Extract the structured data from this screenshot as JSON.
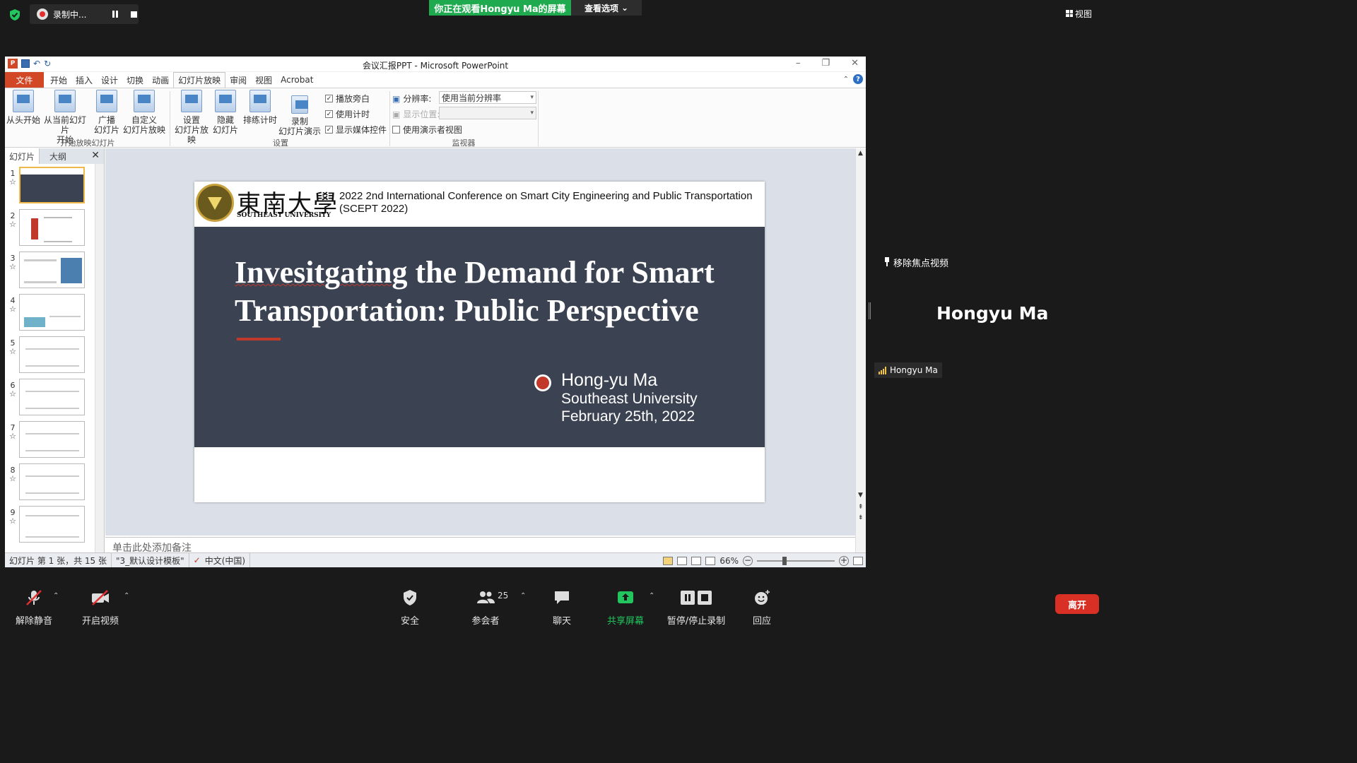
{
  "zoom_top": {
    "recording_label": "录制中...",
    "share_banner": "你正在观看Hongyu  Ma的屏幕",
    "view_options": "查看选项",
    "view_button": "视图"
  },
  "ppt": {
    "window_title": "会议汇报PPT - Microsoft PowerPoint",
    "tabs": [
      "文件",
      "开始",
      "插入",
      "设计",
      "切换",
      "动画",
      "幻灯片放映",
      "审阅",
      "视图",
      "Acrobat"
    ],
    "ribbon": {
      "from_start": "从头开始",
      "from_current_1": "从当前幻灯片",
      "from_current_2": "开始",
      "broadcast_1": "广播",
      "broadcast_2": "幻灯片",
      "custom_1": "自定义",
      "custom_2": "幻灯片放映",
      "group_start": "开始放映幻灯片",
      "setup_1": "设置",
      "setup_2": "幻灯片放映",
      "hide_1": "隐藏",
      "hide_2": "幻灯片",
      "rehearse": "排练计时",
      "record_1": "录制",
      "record_2": "幻灯片演示",
      "chk_narration": "播放旁白",
      "chk_timing": "使用计时",
      "chk_media": "显示媒体控件",
      "group_setup": "设置",
      "resolution_label": "分辨率:",
      "resolution_value": "使用当前分辨率",
      "show_on_label": "显示位置:",
      "presenter_view": "使用演示者视图",
      "group_monitors": "监视器"
    },
    "panel": {
      "tab_slides": "幻灯片",
      "tab_outline": "大纲",
      "thumbs": [
        "1",
        "2",
        "3",
        "4",
        "5",
        "6",
        "7",
        "8",
        "9"
      ]
    },
    "slide": {
      "university_cn": "東南大學",
      "university_en": "SOUTHEAST UNIVERSITY",
      "conference": "2022 2nd International Conference on Smart City Engineering and Public Transportation (SCEPT 2022)",
      "title_word1": "Invesitgating",
      "title_rest1": " the Demand for Smart",
      "title_line2": "Transportation: Public Perspective",
      "author": "Hong-yu  Ma",
      "affiliation": "Southeast University",
      "date": "February 25th, 2022"
    },
    "notes_placeholder": "单击此处添加备注",
    "status": {
      "slide_count": "幻灯片 第 1 张，共 15 张",
      "theme": "\"3_默认设计模板\"",
      "language": "中文(中国)",
      "zoom": "66%"
    }
  },
  "right_panel": {
    "remove_focus": "移除焦点视频",
    "big_name": "Hongyu Ma",
    "small_name": "Hongyu Ma"
  },
  "toolbar": {
    "unmute": "解除静音",
    "start_video": "开启视频",
    "security": "安全",
    "participants": "参会者",
    "participants_count": "25",
    "chat": "聊天",
    "share_screen": "共享屏幕",
    "pause_recording": "暂停/停止录制",
    "reactions": "回应",
    "leave": "离开"
  },
  "colors": {
    "zoom_green": "#1faa4f",
    "ppt_orange": "#d24726",
    "slide_dark": "#3b4252",
    "accent_red": "#c0392b",
    "leave_red": "#d93025"
  }
}
